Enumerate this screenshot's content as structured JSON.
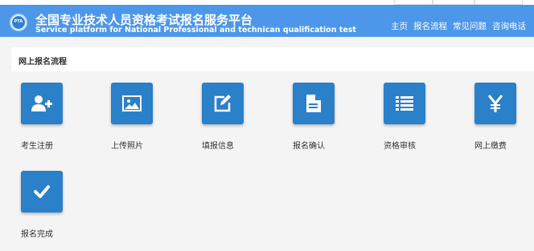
{
  "header": {
    "logo_text": "PTA",
    "title_cn": "全国专业技术人员资格考试报名服务平台",
    "title_en": "Service platform for National Professional and technican qualification test",
    "nav": [
      "主页",
      "报名流程",
      "常见问题",
      "咨询电话"
    ],
    "color": "#4d97ea"
  },
  "section": {
    "title": "网上报名流程"
  },
  "steps": [
    {
      "label": "考生注册",
      "icon": "add-user-icon"
    },
    {
      "label": "上传照片",
      "icon": "image-icon"
    },
    {
      "label": "填报信息",
      "icon": "edit-icon"
    },
    {
      "label": "报名确认",
      "icon": "document-icon"
    },
    {
      "label": "资格审核",
      "icon": "list-icon"
    },
    {
      "label": "网上缴费",
      "icon": "yen-icon"
    },
    {
      "label": "报名完成",
      "icon": "check-icon"
    }
  ],
  "colors": {
    "tile": "#2a80c9",
    "page_bg": "#f4f4f4"
  }
}
